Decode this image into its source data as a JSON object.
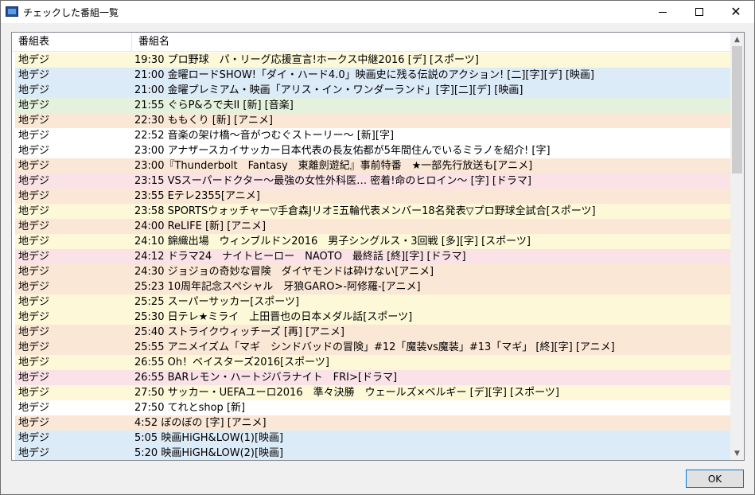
{
  "window": {
    "title": "チェックした番組一覧"
  },
  "titlebar": {
    "minimize": "—",
    "maximize": "☐",
    "close": "✕"
  },
  "table": {
    "headers": [
      "番組表",
      "番組名"
    ],
    "rows": [
      {
        "channel": "地デジ",
        "program": "19:30 プロ野球　パ・リーグ応援宣言!ホークス中継2016 [デ] [スポーツ]",
        "color": "#fcf8d8"
      },
      {
        "channel": "地デジ",
        "program": "21:00 金曜ロードSHOW!「ダイ・ハード4.0」映画史に残る伝説のアクション! [二][字][デ] [映画]",
        "color": "#dcebf8"
      },
      {
        "channel": "地デジ",
        "program": "21:00 金曜プレミアム・映画「アリス・イン・ワンダーランド」[字][二][デ] [映画]",
        "color": "#dcebf8"
      },
      {
        "channel": "地デジ",
        "program": "21:55 ぐらP&ろで夫II [新] [音楽]",
        "color": "#e3f1dd"
      },
      {
        "channel": "地デジ",
        "program": "22:30 ももくり [新] [アニメ]",
        "color": "#fbe7d6"
      },
      {
        "channel": "地デジ",
        "program": "22:52 音楽の架け橋～音がつむぐストーリー～ [新][字]",
        "color": "#ffffff"
      },
      {
        "channel": "地デジ",
        "program": "23:00 アナザースカイサッカー日本代表の長友佑都が5年間住んでいるミラノを紹介! [字]",
        "color": "#ffffff"
      },
      {
        "channel": "地デジ",
        "program": "23:00『Thunderbolt　Fantasy　東離劍遊紀』事前特番　★一部先行放送も[アニメ]",
        "color": "#fbe7d6"
      },
      {
        "channel": "地デジ",
        "program": "23:15 VSスーパードクター～最強の女性外科医… 密着!命のヒロイン～ [字] [ドラマ]",
        "color": "#fbe2e7"
      },
      {
        "channel": "地デジ",
        "program": "23:55 Eテレ2355[アニメ]",
        "color": "#fbe7d6"
      },
      {
        "channel": "地デジ",
        "program": "23:58 SPORTSウォッチャー▽手倉森JリオΞ五輪代表メンバー18名発表▽プロ野球全試合[スポーツ]",
        "color": "#fcf8d8"
      },
      {
        "channel": "地デジ",
        "program": "24:00 ReLIFE [新] [アニメ]",
        "color": "#fbe7d6"
      },
      {
        "channel": "地デジ",
        "program": "24:10 錦織出場　ウィンブルドン2016　男子シングルス・3回戦 [多][字] [スポーツ]",
        "color": "#fcf8d8"
      },
      {
        "channel": "地デジ",
        "program": "24:12 ドラマ24　ナイトヒーロー　NAOTO　最終話 [終][字] [ドラマ]",
        "color": "#fbe2e7"
      },
      {
        "channel": "地デジ",
        "program": "24:30 ジョジョの奇妙な冒険　ダイヤモンドは砕けない[アニメ]",
        "color": "#fbe7d6"
      },
      {
        "channel": "地デジ",
        "program": "25:23 10周年記念スペシャル　牙狼GARO>-阿修羅-[アニメ]",
        "color": "#fbe7d6"
      },
      {
        "channel": "地デジ",
        "program": "25:25 スーパーサッカー[スポーツ]",
        "color": "#fcf8d8"
      },
      {
        "channel": "地デジ",
        "program": "25:30 日テレ★ミライ　上田晋也の日本メダル話[スポーツ]",
        "color": "#fcf8d8"
      },
      {
        "channel": "地デジ",
        "program": "25:40 ストライクウィッチーズ [再] [アニメ]",
        "color": "#fbe7d6"
      },
      {
        "channel": "地デジ",
        "program": "25:55 アニメイズム「マギ　シンドバッドの冒険」#12「魔装vs魔装」#13「マギ」 [終][字] [アニメ]",
        "color": "#fbe7d6"
      },
      {
        "channel": "地デジ",
        "program": "26:55 Oh！ベイスターズ2016[スポーツ]",
        "color": "#fcf8d8"
      },
      {
        "channel": "地デジ",
        "program": "26:55 BARレモン・ハートジバラナイト　FRI>[ドラマ]",
        "color": "#fbe2e7"
      },
      {
        "channel": "地デジ",
        "program": "27:50 サッカー・UEFAユーロ2016　準々決勝　ウェールズ×ベルギー [デ][字] [スポーツ]",
        "color": "#fcf8d8"
      },
      {
        "channel": "地デジ",
        "program": "27:50 てれとshop [新]",
        "color": "#ffffff"
      },
      {
        "channel": "地デジ",
        "program": "4:52 ぼのぼの [字] [アニメ]",
        "color": "#fbe7d6"
      },
      {
        "channel": "地デジ",
        "program": "5:05 映画HiGH&LOW(1)[映画]",
        "color": "#dcebf8"
      },
      {
        "channel": "地デジ",
        "program": "5:20 映画HiGH&LOW(2)[映画]",
        "color": "#dcebf8"
      }
    ]
  },
  "footer": {
    "ok_label": "OK"
  },
  "colors": {
    "accent": "#0078d7",
    "border": "#828790"
  }
}
